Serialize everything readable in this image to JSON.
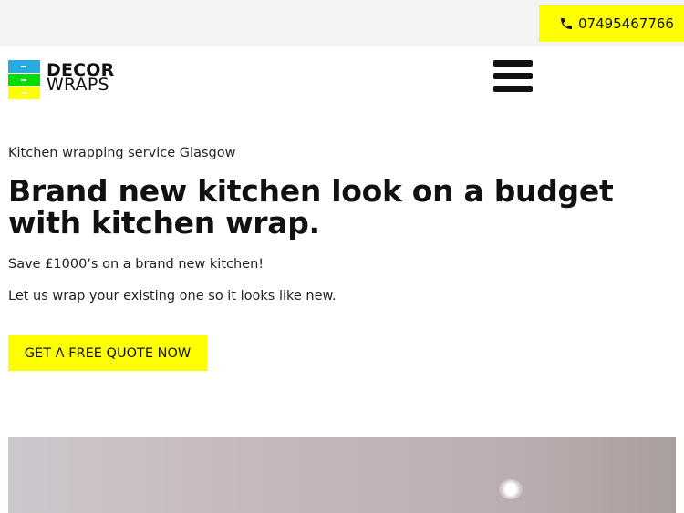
{
  "topbar": {
    "phone": "07495467766",
    "phone_icon": "phone-icon",
    "button_color": "#ffff00"
  },
  "logo": {
    "line1": "DECOR",
    "line2": "WRAPS",
    "colors": [
      "#29abe2",
      "#00dd00",
      "#ffff00"
    ]
  },
  "nav": {
    "menu_icon": "hamburger-menu-icon"
  },
  "hero": {
    "kicker": "Kitchen wrapping service Glasgow",
    "headline": "Brand new kitchen look on a budget with kitchen wrap.",
    "paragraph1": "Save £1000’s on a brand new kitchen!",
    "paragraph2": "Let us wrap your existing one so it looks like new.",
    "cta_label": "GET A FREE QUOTE NOW"
  }
}
